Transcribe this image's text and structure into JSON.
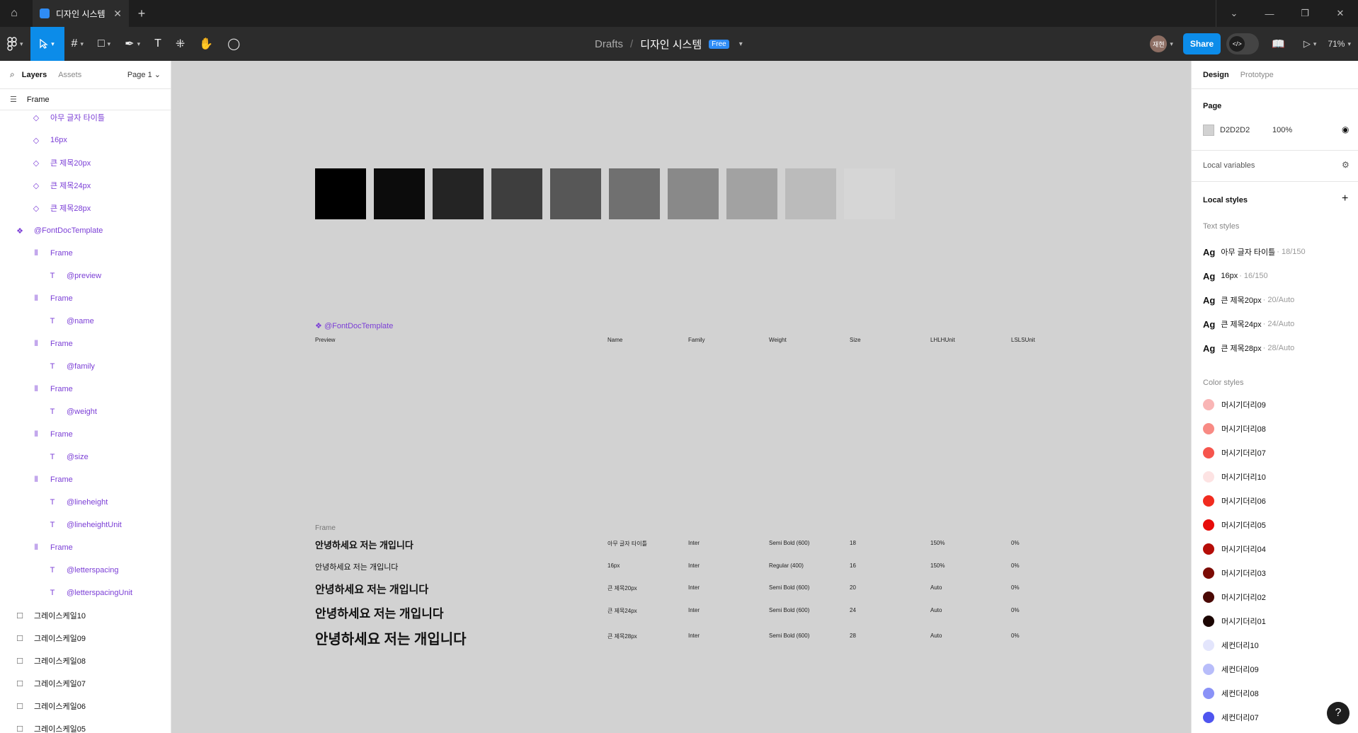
{
  "titlebar": {
    "tab_title": "디자인 시스템",
    "close": "✕",
    "new_tab": "+",
    "chevron": "⌄",
    "minimize": "—",
    "restore": "❐",
    "window_close": "✕"
  },
  "toolbar": {
    "breadcrumb_root": "Drafts",
    "breadcrumb_sep": "/",
    "file_name": "디자인 시스템",
    "plan_badge": "Free",
    "avatar_initials": "재현",
    "share_label": "Share",
    "zoom": "71%"
  },
  "left_panel": {
    "tab_layers": "Layers",
    "tab_assets": "Assets",
    "page_selector": "Page 1",
    "root_frame": "Frame",
    "layers": [
      {
        "label": "아무 글자 타이틀",
        "icon": "component-variant-icon",
        "type": "variant"
      },
      {
        "label": "16px",
        "icon": "component-variant-icon",
        "type": "variant"
      },
      {
        "label": "큰 제목20px",
        "icon": "component-variant-icon",
        "type": "variant"
      },
      {
        "label": "큰 제목24px",
        "icon": "component-variant-icon",
        "type": "variant"
      },
      {
        "label": "큰 제목28px",
        "icon": "component-variant-icon",
        "type": "variant"
      },
      {
        "label": "@FontDocTemplate",
        "icon": "component-icon",
        "type": "component"
      },
      {
        "label": "Frame",
        "icon": "auto-layout-icon",
        "type": "frame"
      },
      {
        "label": "@preview",
        "icon": "text-icon",
        "type": "text"
      },
      {
        "label": "Frame",
        "icon": "auto-layout-icon",
        "type": "frame"
      },
      {
        "label": "@name",
        "icon": "text-icon",
        "type": "text"
      },
      {
        "label": "Frame",
        "icon": "auto-layout-icon",
        "type": "frame"
      },
      {
        "label": "@family",
        "icon": "text-icon",
        "type": "text"
      },
      {
        "label": "Frame",
        "icon": "auto-layout-icon",
        "type": "frame"
      },
      {
        "label": "@weight",
        "icon": "text-icon",
        "type": "text"
      },
      {
        "label": "Frame",
        "icon": "auto-layout-icon",
        "type": "frame"
      },
      {
        "label": "@size",
        "icon": "text-icon",
        "type": "text"
      },
      {
        "label": "Frame",
        "icon": "auto-layout-icon",
        "type": "frame"
      },
      {
        "label": "@lineheight",
        "icon": "text-icon",
        "type": "text"
      },
      {
        "label": "@lineheightUnit",
        "icon": "text-icon",
        "type": "text"
      },
      {
        "label": "Frame",
        "icon": "auto-layout-icon",
        "type": "frame"
      },
      {
        "label": "@letterspacing",
        "icon": "text-icon",
        "type": "text"
      },
      {
        "label": "@letterspacingUnit",
        "icon": "text-icon",
        "type": "text"
      },
      {
        "label": "그레이스케일10",
        "icon": "rectangle-icon",
        "type": "rect"
      },
      {
        "label": "그레이스케일09",
        "icon": "rectangle-icon",
        "type": "rect"
      },
      {
        "label": "그레이스케일08",
        "icon": "rectangle-icon",
        "type": "rect"
      },
      {
        "label": "그레이스케일07",
        "icon": "rectangle-icon",
        "type": "rect"
      },
      {
        "label": "그레이스케일06",
        "icon": "rectangle-icon",
        "type": "rect"
      },
      {
        "label": "그레이스케일05",
        "icon": "rectangle-icon",
        "type": "rect"
      }
    ]
  },
  "canvas": {
    "swatch_colors": [
      "#000000",
      "#0c0c0c",
      "#242424",
      "#3e3e3e",
      "#575757",
      "#707070",
      "#898989",
      "#a2a2a2",
      "#bbbbbb",
      "#d6d6d6"
    ],
    "component_label": "@FontDocTemplate",
    "headers": [
      "Preview",
      "Name",
      "Family",
      "Weight",
      "Size",
      "LHLHUnit",
      "LSLSUnit"
    ],
    "frame_label": "Frame",
    "rows": [
      {
        "preview": "안녕하세요 저는 개입니다",
        "name": "아무 글자 타이틀",
        "family": "Inter",
        "weight": "Semi Bold (600)",
        "size": "18",
        "lh": "150%",
        "ls": "0%"
      },
      {
        "preview": "안녕하세요 저는 개입니다",
        "name": "16px",
        "family": "Inter",
        "weight": "Regular (400)",
        "size": "16",
        "lh": "150%",
        "ls": "0%"
      },
      {
        "preview": "안녕하세요 저는 개입니다",
        "name": "큰 제목20px",
        "family": "Inter",
        "weight": "Semi Bold (600)",
        "size": "20",
        "lh": "Auto",
        "ls": "0%"
      },
      {
        "preview": "안녕하세요 저는 개입니다",
        "name": "큰 제목24px",
        "family": "Inter",
        "weight": "Semi Bold (600)",
        "size": "24",
        "lh": "Auto",
        "ls": "0%"
      },
      {
        "preview": "안녕하세요 저는 개입니다",
        "name": "큰 제목28px",
        "family": "Inter",
        "weight": "Semi Bold (600)",
        "size": "28",
        "lh": "Auto",
        "ls": "0%"
      }
    ]
  },
  "right_panel": {
    "tab_design": "Design",
    "tab_prototype": "Prototype",
    "page_section": "Page",
    "page_color_hex": "D2D2D2",
    "page_color": "#d2d2d2",
    "page_opacity": "100%",
    "local_variables": "Local variables",
    "local_styles": "Local styles",
    "text_styles_label": "Text styles",
    "text_styles": [
      {
        "name": "아무 글자 타이틀",
        "meta": "· 18/150"
      },
      {
        "name": "16px",
        "meta": "· 16/150"
      },
      {
        "name": "큰 제목20px",
        "meta": "· 20/Auto"
      },
      {
        "name": "큰 제목24px",
        "meta": "· 24/Auto"
      },
      {
        "name": "큰 제목28px",
        "meta": "· 28/Auto"
      }
    ],
    "color_styles_label": "Color styles",
    "color_styles": [
      {
        "name": "머시기더리09",
        "color": "#f9b5b5"
      },
      {
        "name": "머시기더리08",
        "color": "#f88a84"
      },
      {
        "name": "머시기더리07",
        "color": "#f6554d"
      },
      {
        "name": "머시기더리10",
        "color": "#fde3e3"
      },
      {
        "name": "머시기더리06",
        "color": "#f12b1f"
      },
      {
        "name": "머시기더리05",
        "color": "#e70c0a"
      },
      {
        "name": "머시기더리04",
        "color": "#b50d08"
      },
      {
        "name": "머시기더리03",
        "color": "#7c0b05"
      },
      {
        "name": "머시기더리02",
        "color": "#4a0804"
      },
      {
        "name": "머시기더리01",
        "color": "#1b0502"
      },
      {
        "name": "세컨더리10",
        "color": "#e3e5fc"
      },
      {
        "name": "세컨더리09",
        "color": "#b8bdfa"
      },
      {
        "name": "세컨더리08",
        "color": "#8a92f7"
      },
      {
        "name": "세컨더리07",
        "color": "#4f55ef"
      }
    ],
    "help": "?"
  }
}
